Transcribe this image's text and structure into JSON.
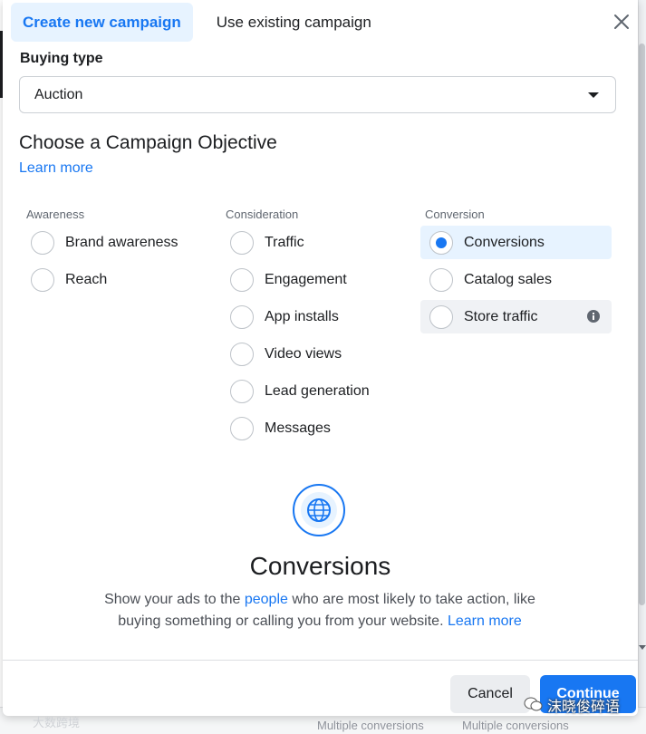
{
  "tabs": [
    {
      "label": "Create new campaign",
      "active": true
    },
    {
      "label": "Use existing campaign",
      "active": false
    }
  ],
  "buying_type": {
    "label": "Buying type",
    "value": "Auction"
  },
  "heading": "Choose a Campaign Objective",
  "learn_more": "Learn more",
  "columns": {
    "awareness": {
      "title": "Awareness",
      "options": [
        "Brand awareness",
        "Reach"
      ]
    },
    "consideration": {
      "title": "Consideration",
      "options": [
        "Traffic",
        "Engagement",
        "App installs",
        "Video views",
        "Lead generation",
        "Messages"
      ]
    },
    "conversion": {
      "title": "Conversion",
      "options": [
        "Conversions",
        "Catalog sales",
        "Store traffic"
      ]
    }
  },
  "selected_objective": "Conversions",
  "detail": {
    "icon": "globe-icon",
    "title": "Conversions",
    "desc_part1": "Show your ads to the ",
    "desc_link1": "people",
    "desc_part2": " who are most likely to take action, like buying something or calling you from your website. ",
    "desc_link2": "Learn more"
  },
  "footer": {
    "cancel": "Cancel",
    "continue": "Continue"
  },
  "background": {
    "bottom_text_1": "Multiple conversions",
    "bottom_text_2": "Multiple conversions"
  },
  "watermark": {
    "text_right": "沫晓俊碎语",
    "text_left": "大数跨境"
  },
  "colors": {
    "accent": "#1877f2",
    "selected_bg": "#e7f3ff",
    "hover_bg": "#f0f2f5"
  }
}
